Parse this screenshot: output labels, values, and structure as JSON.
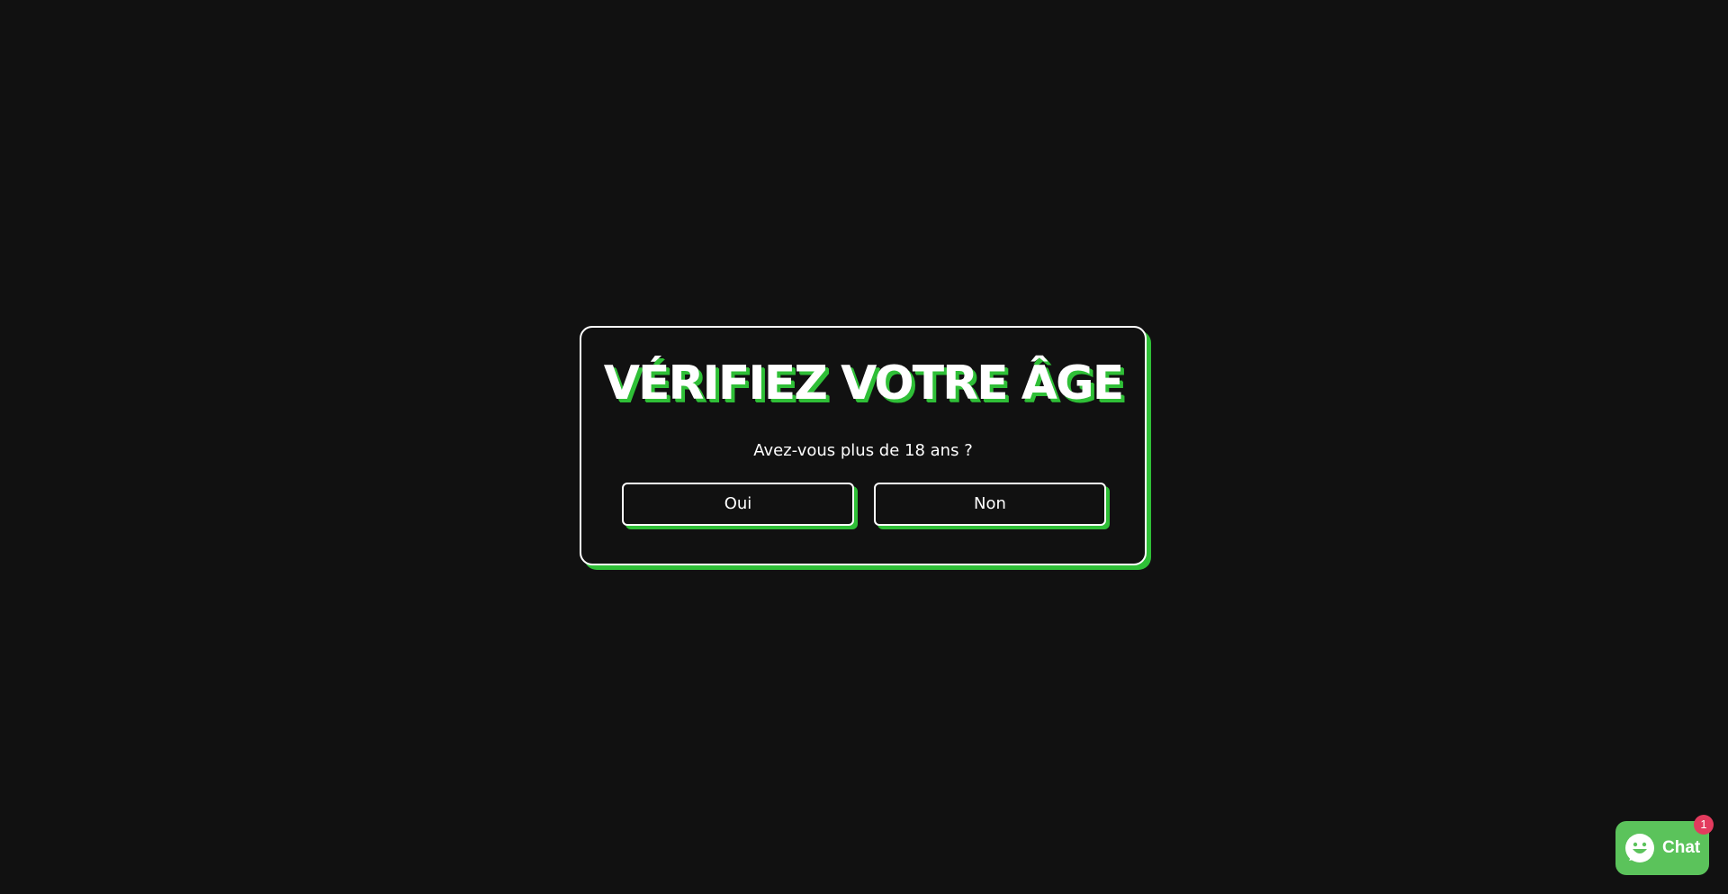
{
  "age_gate": {
    "title": "VÉRIFIEZ VOTRE ÂGE",
    "question": "Avez-vous plus de 18 ans ?",
    "yes_label": "Oui",
    "no_label": "Non"
  },
  "chat": {
    "label": "Chat",
    "badge_count": "1",
    "icon": "chat-smiley-icon"
  },
  "colors": {
    "background": "#111111",
    "accent": "#2fbf37",
    "chat_button": "#5bc35b",
    "badge": "#e33b5e",
    "text": "#ffffff"
  }
}
